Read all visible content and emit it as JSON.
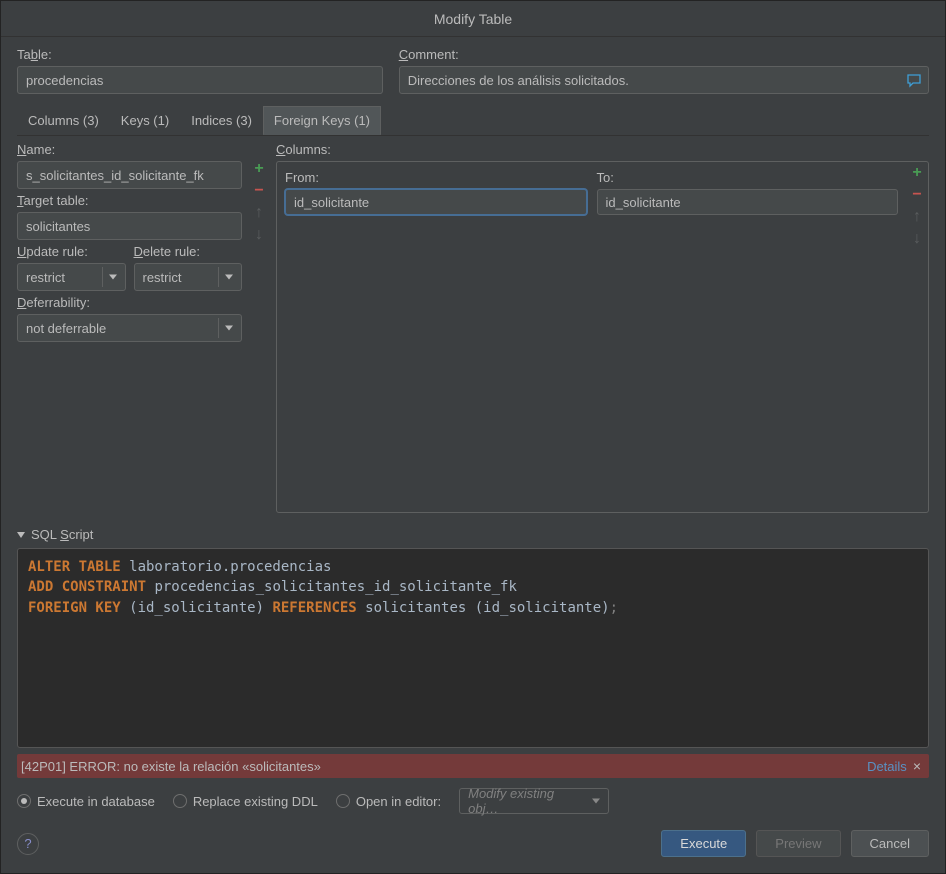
{
  "window": {
    "title": "Modify Table"
  },
  "top": {
    "table_label": "Table:",
    "table_value": "procedencias",
    "comment_label": "Comment:",
    "comment_value": "Direcciones de los análisis solicitados."
  },
  "tabs": {
    "columns": "Columns (3)",
    "keys": "Keys (1)",
    "indices": "Indices (3)",
    "foreign_keys": "Foreign Keys (1)"
  },
  "fk": {
    "name_label": "Name:",
    "name_value": "s_solicitantes_id_solicitante_fk",
    "target_label": "Target table:",
    "target_value": "solicitantes",
    "update_label": "Update rule:",
    "update_value": "restrict",
    "delete_label": "Delete rule:",
    "delete_value": "restrict",
    "defer_label": "Deferrability:",
    "defer_value": "not deferrable",
    "columns_label": "Columns:",
    "from_label": "From:",
    "to_label": "To:",
    "from_value": "id_solicitante",
    "to_value": "id_solicitante"
  },
  "sql": {
    "header": "SQL Script",
    "lines": {
      "l1a": "ALTER TABLE",
      "l1b": " laboratorio.procedencias",
      "l2a": "ADD CONSTRAINT",
      "l2b": " procedencias_solicitantes_id_solicitante_fk",
      "l3a": "FOREIGN KEY",
      "l3b": " (id_solicitante) ",
      "l3c": "REFERENCES",
      "l3d": " solicitantes (id_solicitante)",
      "l3e": ";"
    }
  },
  "error": {
    "text": "[42P01] ERROR: no existe la relación «solicitantes»",
    "details": "Details"
  },
  "radios": {
    "execute": "Execute in database",
    "replace": "Replace existing DDL",
    "open": "Open in editor:",
    "editor_select": "Modify existing obj…"
  },
  "buttons": {
    "execute": "Execute",
    "preview": "Preview",
    "cancel": "Cancel"
  }
}
